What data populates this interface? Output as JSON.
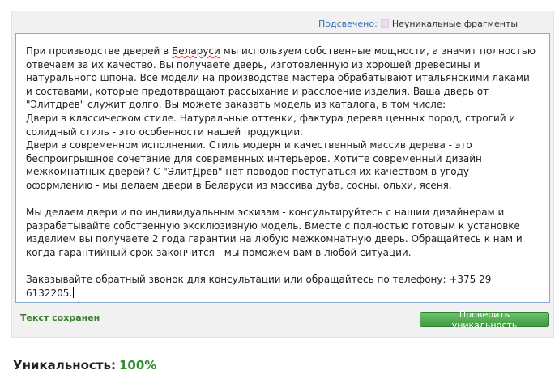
{
  "legend": {
    "link_label": "Подсвечено",
    "colon": ":",
    "swatch_label": "Неуникальные фрагменты",
    "swatch_color": "#ecdcf0"
  },
  "editor": {
    "p1_before": "При производстве дверей в ",
    "p1_spell": "Беларуси",
    "p1_after": " мы используем собственные мощности, а значит полностью отвечаем за их качество. Вы получаете дверь, изготовленную из хорошей древесины и натурального шпона. Все модели на производстве мастера обрабатывают итальянскими лаками и составами, которые предотвращают рассыхание и расслоение изделия. Ваша дверь от \"Элитдрев\" служит долго. Вы можете заказать модель из каталога, в том числе:",
    "p2": "Двери в классическом стиле. Натуральные оттенки, фактура дерева ценных пород, строгий и солидный стиль - это особенности нашей продукции.",
    "p3": "Двери в современном исполнении. Стиль модерн и качественный массив дерева - это беспроигрышное сочетание для современных интерьеров. Хотите современный дизайн межкомнатных дверей? С \"ЭлитДрев\" нет поводов поступаться их качеством в угоду оформлению - мы делаем двери в Беларуси из массива дуба, сосны, ольхи, ясеня.",
    "p4": "Мы делаем двери и по индивидуальным эскизам - консультируйтесь с нашим дизайнерам и разрабатывайте собственную эксклюзивную модель. Вместе с полностью готовым к установке изделием вы получаете 2 года гарантии на любую межкомнатную дверь. Обращайтесь к нам и когда гарантийный срок закончится - мы поможем вам в любой ситуации.",
    "p5": "Заказывайте обратный звонок для консультации или обращайтесь по телефону: +375 29 6132205."
  },
  "status": {
    "saved_label": "Текст сохранен",
    "saved_color": "#3a7d2a"
  },
  "actions": {
    "check_label": "Проверить уникальность",
    "button_color": "#4caf50"
  },
  "result": {
    "label": "Уникальность:",
    "value": "100%",
    "value_color": "#2e8b2e"
  }
}
